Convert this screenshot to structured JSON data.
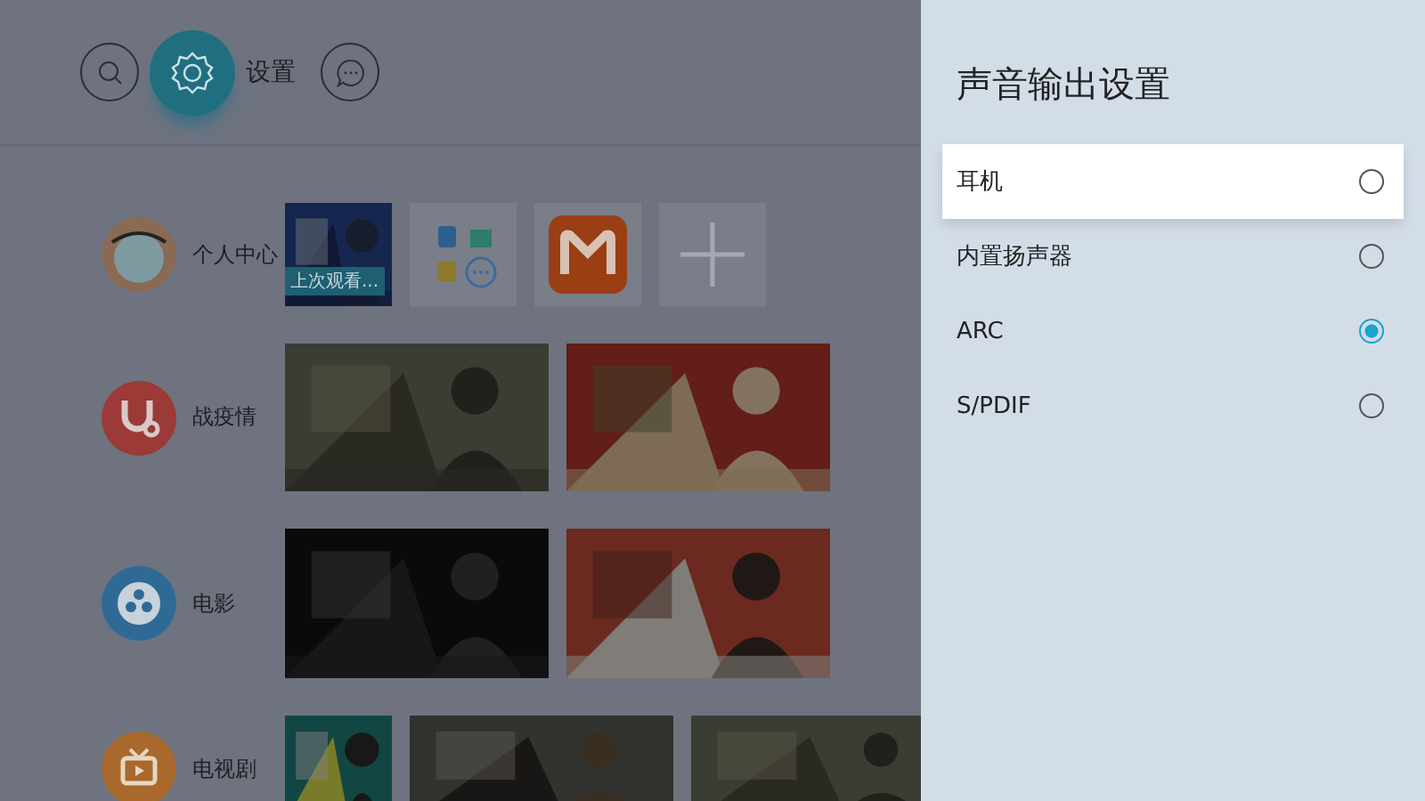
{
  "top_nav": [
    {
      "kind": "search",
      "selected": false
    },
    {
      "kind": "settings",
      "selected": true,
      "label": "设置"
    },
    {
      "kind": "message",
      "selected": false
    }
  ],
  "categories": [
    {
      "kind": "profile",
      "name": "个人中心",
      "tiles": [
        {
          "kind": "picture",
          "caption": "上次观看..."
        },
        {
          "kind": "apps"
        },
        {
          "kind": "app-logo"
        },
        {
          "kind": "add"
        }
      ]
    },
    {
      "kind": "medical",
      "name": "战疫情"
    },
    {
      "kind": "movie",
      "name": "电影"
    },
    {
      "kind": "tv",
      "name": "电视剧"
    }
  ],
  "panel": {
    "title": "声音输出设置",
    "options": [
      {
        "label": "耳机",
        "focused": true,
        "selected": false
      },
      {
        "label": "内置扬声器",
        "focused": false,
        "selected": false
      },
      {
        "label": "ARC",
        "focused": false,
        "selected": true
      },
      {
        "label": "S/PDIF",
        "focused": false,
        "selected": false
      }
    ]
  }
}
